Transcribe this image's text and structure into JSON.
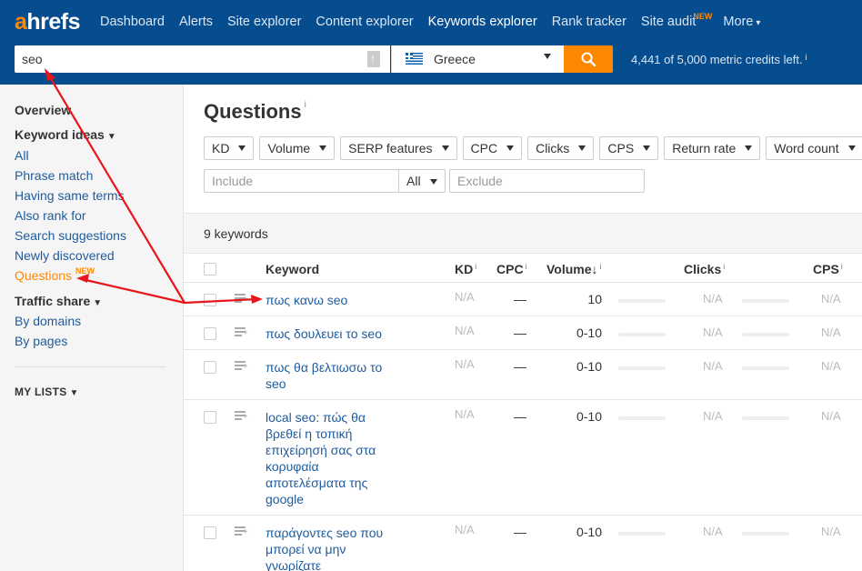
{
  "app": {
    "logo_a": "a",
    "logo_rest": "hrefs"
  },
  "nav": [
    {
      "label": "Dashboard"
    },
    {
      "label": "Alerts"
    },
    {
      "label": "Site explorer"
    },
    {
      "label": "Content explorer"
    },
    {
      "label": "Keywords explorer",
      "active": true
    },
    {
      "label": "Rank tracker"
    },
    {
      "label": "Site audit",
      "badge": "NEW"
    },
    {
      "label": "More",
      "caret": "▾"
    }
  ],
  "search": {
    "value": "seo"
  },
  "country": {
    "name": "Greece"
  },
  "credits": {
    "text": "4,441 of 5,000 metric credits left.",
    "info": "i"
  },
  "sidebar": {
    "overview": "Overview",
    "keyword_ideas": "Keyword ideas",
    "keyword_links": [
      "All",
      "Phrase match",
      "Having same terms",
      "Also rank for",
      "Search suggestions",
      "Newly discovered"
    ],
    "questions": "Questions",
    "questions_badge": "NEW",
    "traffic_share": "Traffic share",
    "traffic_links": [
      "By domains",
      "By pages"
    ],
    "my_lists": "MY LISTS"
  },
  "page": {
    "title": "Questions",
    "title_info": "i"
  },
  "filters": [
    "KD",
    "Volume",
    "SERP features",
    "CPC",
    "Clicks",
    "CPS",
    "Return rate",
    "Word count"
  ],
  "include": {
    "placeholder": "Include",
    "mode": "All"
  },
  "exclude": {
    "placeholder": "Exclude"
  },
  "results": {
    "count_text": "9 keywords"
  },
  "table": {
    "headers": {
      "keyword": "Keyword",
      "kd": "KD",
      "cpc": "CPC",
      "volume": "Volume",
      "volume_sort": "↓",
      "clicks": "Clicks",
      "cps": "CPS",
      "info": "i"
    },
    "rows": [
      {
        "keyword": "πως κανω seo",
        "kd": "N/A",
        "cpc": "—",
        "volume": "10",
        "clicks": "N/A",
        "cps": "N/A"
      },
      {
        "keyword": "πως δουλευει το seo",
        "kd": "N/A",
        "cpc": "—",
        "volume": "0-10",
        "clicks": "N/A",
        "cps": "N/A"
      },
      {
        "keyword": "πως θα βελτιωσω το seo",
        "kd": "N/A",
        "cpc": "—",
        "volume": "0-10",
        "clicks": "N/A",
        "cps": "N/A"
      },
      {
        "keyword": "local seo: πώς θα βρεθεί η τοπική επιχείρησή σας στα κορυφαία αποτελέσματα της google",
        "kd": "N/A",
        "cpc": "—",
        "volume": "0-10",
        "clicks": "N/A",
        "cps": "N/A"
      },
      {
        "keyword": "παράγοντες seo που μπορεί να μην γνωρίζατε",
        "kd": "N/A",
        "cpc": "—",
        "volume": "0-10",
        "clicks": "N/A",
        "cps": "N/A"
      }
    ]
  },
  "colors": {
    "topbar": "#054d8f",
    "accent": "#ff8800",
    "link": "#1e5b9e",
    "annotation": "#e8151b"
  }
}
